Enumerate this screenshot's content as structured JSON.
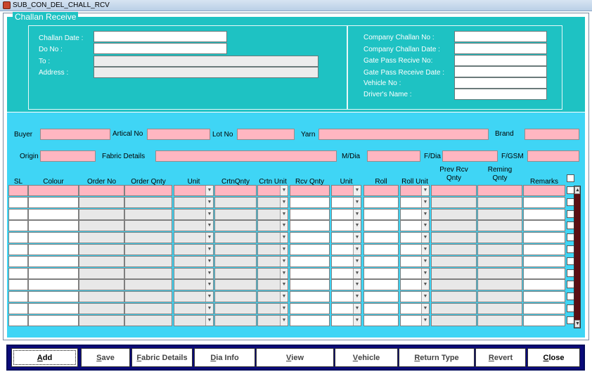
{
  "window": {
    "title": "SUB_CON_DEL_CHALL_RCV",
    "icon": "app-icon"
  },
  "section_title": "Challan Receive",
  "left_form": {
    "challan_date": {
      "label": "Challan  Date :",
      "value": ""
    },
    "do_no": {
      "label": "Do No :",
      "value": ""
    },
    "to": {
      "label": "To :",
      "value": ""
    },
    "address": {
      "label": "Address :",
      "value": ""
    }
  },
  "right_form": {
    "company_challan_no": {
      "label": "Company Challan No :",
      "value": ""
    },
    "company_challan_date": {
      "label": "Company Challan Date :",
      "value": ""
    },
    "gate_pass_recive_no": {
      "label": "Gate Pass Recive No:",
      "value": ""
    },
    "gate_pass_receive_date": {
      "label": "Gate Pass Receive Date :",
      "value": ""
    },
    "vehicle_no": {
      "label": "Vehicle No :",
      "value": ""
    },
    "drivers_name": {
      "label": "Driver's Name :",
      "value": ""
    }
  },
  "filters": {
    "buyer": "Buyer",
    "artical_no": "Artical No",
    "lot_no": "Lot No",
    "yarn": "Yarn",
    "brand": "Brand",
    "origin": "Origin",
    "fabric_details": "Fabric Details",
    "m_dia": "M/Dia",
    "f_dia": "F/Dia",
    "f_gsm": "F/GSM"
  },
  "grid": {
    "headers": [
      "SL",
      "Colour",
      "Order No",
      "Order Qnty",
      "Unit",
      "CrtnQnty",
      "Crtn Unit",
      "Rcv Qnty",
      "Unit",
      "Roll",
      "Roll Unit",
      "Prev Rcv Qnty",
      "Reming Qnty",
      "Remarks"
    ],
    "row_count": 12
  },
  "buttons": [
    {
      "label": "Add",
      "key": "A",
      "rest": "dd"
    },
    {
      "label": "Save",
      "key": "S",
      "rest": "ave"
    },
    {
      "label": "Fabric Details",
      "key": "F",
      "rest": "abric Details"
    },
    {
      "label": "Dia Info",
      "key": "D",
      "rest": "ia Info"
    },
    {
      "label": "View",
      "key": "V",
      "rest": "iew"
    },
    {
      "label": "Vehicle",
      "key": "V",
      "rest": "ehicle"
    },
    {
      "label": "Return Type",
      "key": "R",
      "rest": "eturn Type"
    },
    {
      "label": "Revert",
      "key": "R",
      "rest": "evert"
    },
    {
      "label": "Close",
      "key": "C",
      "rest": "lose"
    }
  ],
  "colors": {
    "header_panel": "#1ec2c3",
    "grid_panel": "#3fd5f5",
    "required": "#ffb6c1",
    "button_bar": "#0a0a7a"
  }
}
